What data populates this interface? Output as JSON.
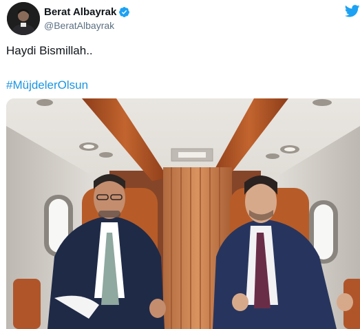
{
  "tweet": {
    "author_name": "Berat Albayrak",
    "author_handle": "@BeratAlbayrak",
    "text": "Haydi Bismillah..",
    "hashtag": "#MüjdelerOlsun"
  },
  "icons": {
    "verified": "verified-badge-icon",
    "platform": "twitter-bird-icon"
  },
  "colors": {
    "link": "#1b95e0",
    "verified": "#1da1f2",
    "bird": "#1da1f2",
    "handle": "#5b7083",
    "text": "#0f1419"
  }
}
